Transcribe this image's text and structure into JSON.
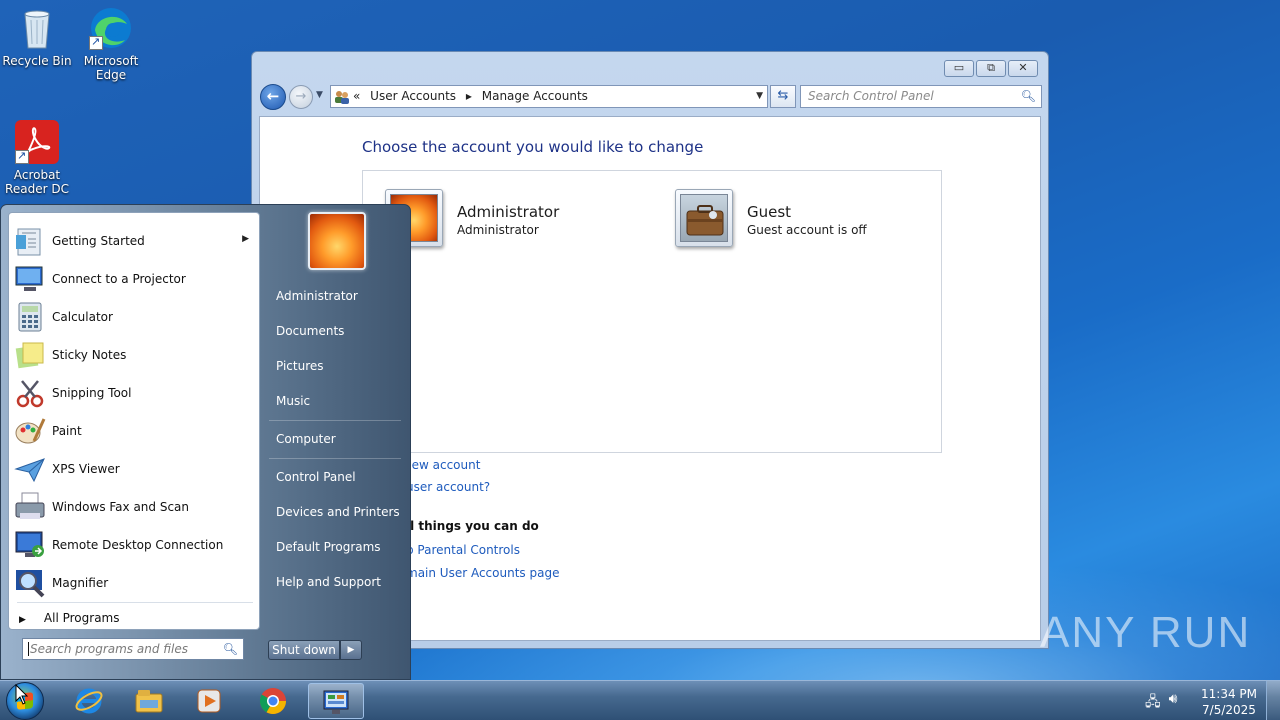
{
  "desktop": {
    "icons": [
      {
        "label": "Recycle Bin"
      },
      {
        "label": "Microsoft Edge"
      },
      {
        "label": "Acrobat Reader DC"
      }
    ],
    "watermark": "ANY RUN"
  },
  "window": {
    "controls": {
      "minimize": "▭",
      "maximize": "⧉",
      "close": "✕"
    },
    "address": {
      "sep": "«",
      "crumbs": [
        "User Accounts",
        "Manage Accounts"
      ]
    },
    "search_placeholder": "Search Control Panel",
    "title": "Choose the account you would like to change",
    "accounts": [
      {
        "name": "Administrator",
        "subtitle": "Administrator"
      },
      {
        "name": "Guest",
        "subtitle": "Guest account is off"
      }
    ],
    "links": {
      "create": "new account",
      "what_is": "user account?",
      "additional_heading": "al things you can do",
      "parental": "p Parental Controls",
      "main_page": "main User Accounts page"
    }
  },
  "start_menu": {
    "programs": [
      {
        "label": "Getting Started",
        "icon": "getting-started-icon",
        "has_submenu": true
      },
      {
        "label": "Connect to a Projector",
        "icon": "projector-icon"
      },
      {
        "label": "Calculator",
        "icon": "calculator-icon"
      },
      {
        "label": "Sticky Notes",
        "icon": "sticky-notes-icon"
      },
      {
        "label": "Snipping Tool",
        "icon": "snipping-tool-icon"
      },
      {
        "label": "Paint",
        "icon": "paint-icon"
      },
      {
        "label": "XPS Viewer",
        "icon": "xps-viewer-icon"
      },
      {
        "label": "Windows Fax and Scan",
        "icon": "fax-scan-icon"
      },
      {
        "label": "Remote Desktop Connection",
        "icon": "remote-desktop-icon"
      },
      {
        "label": "Magnifier",
        "icon": "magnifier-icon"
      }
    ],
    "all_programs": "All Programs",
    "search_placeholder": "Search programs and files",
    "right_items": [
      "Administrator",
      "Documents",
      "Pictures",
      "Music",
      "Computer",
      "Control Panel",
      "Devices and Printers",
      "Default Programs",
      "Help and Support"
    ],
    "shutdown": "Shut down"
  },
  "taskbar": {
    "buttons": [
      "internet-explorer-icon",
      "file-explorer-icon",
      "media-player-icon",
      "chrome-icon",
      "control-panel-icon"
    ],
    "clock_time": "11:34 PM",
    "clock_date": "7/5/2025"
  },
  "colors": {
    "link": "#1e5bbd",
    "heading": "#1e3287"
  }
}
